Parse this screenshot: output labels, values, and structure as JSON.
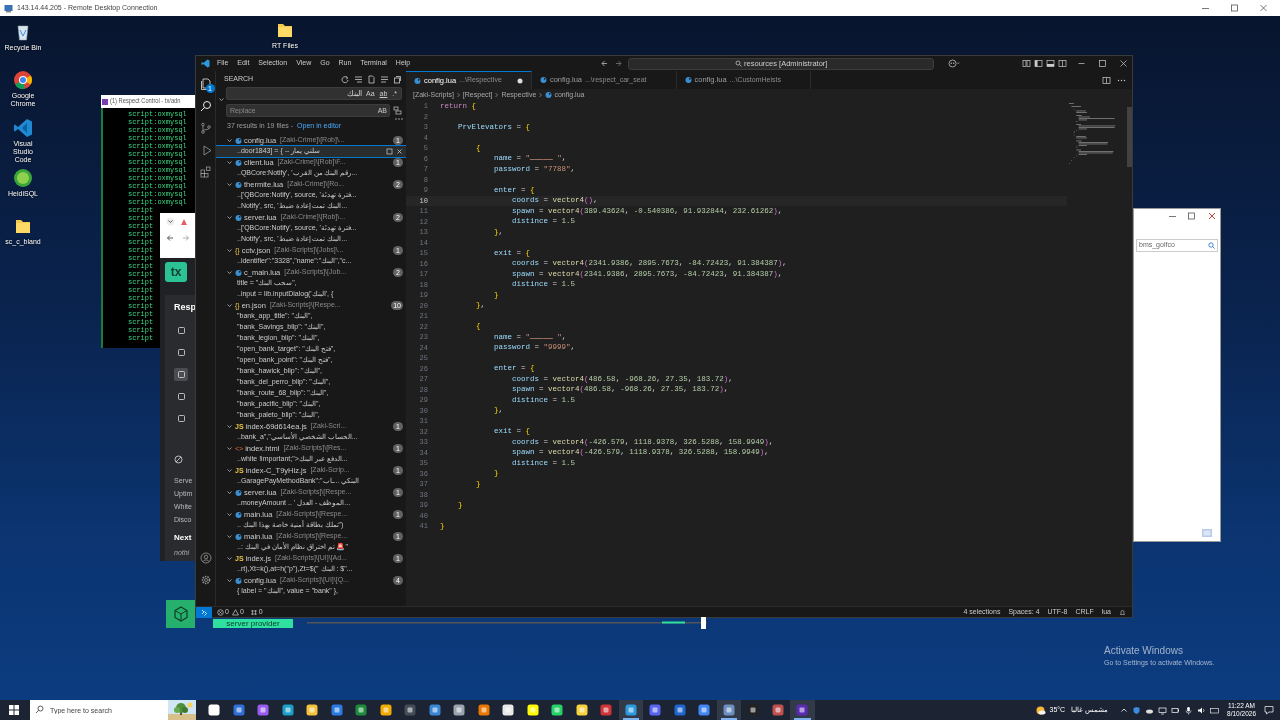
{
  "remote_window": {
    "title": "143.14.44.205 - Remote Desktop Connection"
  },
  "desktop_icons": [
    {
      "label": "Recycle Bin",
      "kind": "recycle"
    },
    {
      "label": "Google Chrome",
      "kind": "chrome"
    },
    {
      "label": "Visual Studio Code",
      "kind": "vscode"
    },
    {
      "label": "HeidiSQL",
      "kind": "heidi"
    },
    {
      "label": "sc_c_bland",
      "kind": "folder"
    },
    {
      "label": "RT Files",
      "kind": "folder"
    }
  ],
  "console_window": {
    "title": "(1) Respect Control - tx/adn",
    "lines": [
      "script:oxmysql",
      "script:oxmysql",
      "script:oxmysql",
      "script:oxmysql",
      "script:oxmysql",
      "script:oxmysql",
      "script:oxmysql",
      "script:oxmysql",
      "script:oxmysql",
      "script:oxmysql",
      "script:oxmysql",
      "script:oxmysql",
      "script",
      "script",
      "script",
      "script",
      "script",
      "script",
      "script",
      "script",
      "script",
      "script",
      "script",
      "script",
      "script",
      "script",
      "script",
      "script",
      "script"
    ]
  },
  "browser_window": {
    "logo": "tx",
    "heading": "Resp",
    "nav": [
      {
        "selected": false
      },
      {
        "selected": false
      },
      {
        "selected": true
      },
      {
        "selected": false
      },
      {
        "selected": false
      }
    ],
    "stats": [
      "Serve",
      "Uptim",
      "White",
      "Disco"
    ],
    "next_heading": "Next",
    "next_text": "nothi"
  },
  "side_window": {
    "search_value": "bms_golfco"
  },
  "editor": {
    "menu": [
      "File",
      "Edit",
      "Selection",
      "View",
      "Go",
      "Run",
      "Terminal",
      "Help"
    ],
    "command_center": "resources [Administrator]",
    "explorer_badge": "1",
    "search": {
      "title": "SEARCH",
      "query": "البنك",
      "toggles": [
        {
          "label": "Aa",
          "on": false
        },
        {
          "label": "ab",
          "on": false
        },
        {
          "label": ".*",
          "on": false
        }
      ],
      "replace_placeholder": "Replace",
      "replace_toggle": "AB",
      "summary": "37 results in 19 files - ",
      "open_link": "Open in editor",
      "files": [
        {
          "kind": "lua",
          "name": "config.lua",
          "path": "[Zaki-Crime]\\[Rob]\\...",
          "count": "1",
          "matches": [
            {
              "text": "..door1843] = { -- سلني يمار",
              "selected": true
            }
          ]
        },
        {
          "kind": "lua",
          "name": "client.lua",
          "path": "[Zaki-Crime]\\[Rob]\\F...",
          "count": "1",
          "matches": [
            {
              "text": "..QBCore:Notify', 'رقم البنك من القرب...",
              "selected": false
            }
          ]
        },
        {
          "kind": "lua",
          "name": "thermite.lua",
          "path": "[Zaki-Crime]\\[Ro...",
          "count": "2",
          "matches": [
            {
              "text": "..['QBCore:Notify', source, 'فترة تهدئة...",
              "selected": false
            },
            {
              "text": "..Notify', src, 'البنك تمت إعادة ضبط...",
              "selected": false
            }
          ]
        },
        {
          "kind": "lua",
          "name": "server.lua",
          "path": "[Zaki-Crime]\\[Rob]\\...",
          "count": "2",
          "matches": [
            {
              "text": "..['QBCore:Notify', source, 'فترة تهدئة...",
              "selected": false
            },
            {
              "text": "..Notify', src, 'البنك تمت إعادة ضبط...",
              "selected": false
            }
          ]
        },
        {
          "kind": "json",
          "icon_text": "{}",
          "name": "cctv.json",
          "path": "[Zaki-Scripts]\\[Jobs]\\...",
          "count": "1",
          "matches": [
            {
              "text": "..identifier\":\"3328\",\"name\":\"البنك\",\"c...",
              "selected": false
            }
          ]
        },
        {
          "kind": "lua",
          "name": "c_main.lua",
          "path": "[Zaki-Scripts]\\[Job...",
          "count": "2",
          "matches": [
            {
              "text": "title = \"سحب البنك\",",
              "selected": false
            },
            {
              "text": "..input = lib.inputDialog('البنك', {",
              "selected": false
            }
          ]
        },
        {
          "kind": "json",
          "icon_text": "{}",
          "name": "en.json",
          "path": "[Zaki-Scripts]\\[Respe...",
          "count": "10",
          "matches": [
            {
              "text": "\"bank_app_title\": \"البنك\",",
              "selected": false
            },
            {
              "text": "\"bank_Savings_blip\": \"البنك\",",
              "selected": false
            },
            {
              "text": "\"bank_legion_blip\": \"البنك\",",
              "selected": false
            },
            {
              "text": "\"open_bank_target\": \"فتح البنك\",",
              "selected": false
            },
            {
              "text": "\"open_bank_point\": \"فتح البنك\",",
              "selected": false
            },
            {
              "text": "\"bank_hawick_blip\": \"البنك\",",
              "selected": false
            },
            {
              "text": "\"bank_del_perro_blip\": \"البنك\",",
              "selected": false
            },
            {
              "text": "\"bank_route_68_blip\": \"البنك\",",
              "selected": false
            },
            {
              "text": "\"bank_pacific_blip\": \"البنك\",",
              "selected": false
            },
            {
              "text": "\"bank_paleto_blip\": \"البنك\",",
              "selected": false
            }
          ]
        },
        {
          "kind": "js",
          "icon_text": "JS",
          "name": "index-69d614ea.js",
          "path": "[Zaki-Scri...",
          "count": "1",
          "matches": [
            {
              "text": "..bank_a\",\"الحساب الشخصي الأساسي...",
              "selected": false
            }
          ]
        },
        {
          "kind": "html",
          "icon_text": "<>",
          "name": "index.html",
          "path": "[Zaki-Scripts]\\[Res...",
          "count": "1",
          "matches": [
            {
              "text": "..white !important;\">الدفع عبر البنك...",
              "selected": false
            }
          ]
        },
        {
          "kind": "js",
          "icon_text": "JS",
          "name": "index-C_T9yHiz.js",
          "path": "[Zaki-Scrip...",
          "count": "1",
          "matches": [
            {
              "text": "..GaragePayMethodBank\":\"البنكي ...ـاب",
              "selected": false
            }
          ]
        },
        {
          "kind": "lua",
          "name": "server.lua",
          "path": "[Zaki-Scripts]\\[Respe...",
          "count": "1",
          "matches": [
            {
              "text": "..moneyAmount .. ' الموظف - العدل...",
              "selected": false
            }
          ]
        },
        {
          "kind": "lua",
          "name": "main.lua",
          "path": "[Zaki-Scripts]\\[Respe...",
          "count": "1",
          "matches": [
            {
              "text": ".. تملك بطاقة أمنية خاصة بهذا البنك\")",
              "selected": false
            }
          ]
        },
        {
          "kind": "lua",
          "name": "main.lua",
          "path": "[Zaki-Scripts]\\[Respe...",
          "count": "1",
          "matches": [
            {
              "text": "..: تم اختراق نظام الأمان في البنك 🚨\"",
              "selected": false
            }
          ]
        },
        {
          "kind": "js",
          "icon_text": "JS",
          "name": "index.js",
          "path": "[Zaki-Scripts]\\[UI]\\[Ad...",
          "count": "1",
          "matches": [
            {
              "text": "..rt),Xt=k(),at=h(\"p\"),Zt=$(\" البنك : $\"...",
              "selected": false
            }
          ]
        },
        {
          "kind": "lua",
          "name": "config.lua",
          "path": "[Zaki-Scripts]\\[UI]\\[Q...",
          "count": "4",
          "matches": [
            {
              "text": "{ label = \"البنك\",  value = \"bank\" },",
              "selected": false
            }
          ]
        }
      ]
    },
    "tabs": [
      {
        "name": "config.lua",
        "path": "...\\RespectIve",
        "selected": true,
        "dirty": true
      },
      {
        "name": "config.lua",
        "path": "...\\respect_car_seat",
        "selected": false,
        "dirty": false
      },
      {
        "name": "config.lua",
        "path": "...\\CustomHeists",
        "selected": false,
        "dirty": false
      }
    ],
    "breadcrumb": [
      "[Zaki-Scripts]",
      "[Respect]",
      "RespectIve",
      "config.lua"
    ],
    "lines": [
      {
        "number": "1",
        "text": "return {",
        "current": false
      },
      {
        "number": "2",
        "current": false
      },
      {
        "number": "3",
        "text": "    PrvElevators = {",
        "current": false
      },
      {
        "number": "4",
        "current": false
      },
      {
        "number": "5",
        "text": "        {",
        "current": false
      },
      {
        "number": "6",
        "text": "            name = \"ـــــ \",",
        "current": false
      },
      {
        "number": "7",
        "text": "            password = \"7788\",",
        "current": false
      },
      {
        "number": "8",
        "current": false
      },
      {
        "number": "9",
        "text": "            enter = {",
        "current": false
      },
      {
        "number": "10",
        "text": "                coords = vector4(),",
        "current": true
      },
      {
        "number": "11",
        "text": "                spawn = vector4(389.43624, -0.540386, 91.932844, 232.61262),",
        "current": false
      },
      {
        "number": "12",
        "text": "                distince = 1.5",
        "current": false
      },
      {
        "number": "13",
        "text": "            },",
        "current": false
      },
      {
        "number": "14",
        "current": false
      },
      {
        "number": "15",
        "text": "            exit = {",
        "current": false
      },
      {
        "number": "16",
        "text": "                coords = vector4(2341.9386, 2895.7673, -84.72423, 91.384387),",
        "current": false
      },
      {
        "number": "17",
        "text": "                spawn = vector4(2341.9386, 2895.7673, -84.72423, 91.384387),",
        "current": false
      },
      {
        "number": "18",
        "text": "                distince = 1.5",
        "current": false
      },
      {
        "number": "19",
        "text": "            }",
        "current": false
      },
      {
        "number": "20",
        "text": "        },",
        "current": false
      },
      {
        "number": "21",
        "current": false
      },
      {
        "number": "22",
        "text": "        {",
        "current": false
      },
      {
        "number": "23",
        "text": "            name = \"ـــــ \",",
        "current": false
      },
      {
        "number": "24",
        "text": "            password = \"9999\",",
        "current": false
      },
      {
        "number": "25",
        "current": false
      },
      {
        "number": "26",
        "text": "            enter = {",
        "current": false
      },
      {
        "number": "27",
        "text": "                coords = vector4(486.58, -968.26, 27.35, 183.72),",
        "current": false
      },
      {
        "number": "28",
        "text": "                spawn = vector4(486.58, -968.26, 27.35, 183.72),",
        "current": false
      },
      {
        "number": "29",
        "text": "                distince = 1.5",
        "current": false
      },
      {
        "number": "30",
        "text": "            },",
        "current": false
      },
      {
        "number": "31",
        "current": false
      },
      {
        "number": "32",
        "text": "            exit = {",
        "current": false
      },
      {
        "number": "33",
        "text": "                coords = vector4(-426.579, 1118.9378, 326.5288, 158.9949),",
        "current": false
      },
      {
        "number": "34",
        "text": "                spawn = vector4(-426.579, 1118.9378, 326.5288, 158.9949),",
        "current": false
      },
      {
        "number": "35",
        "text": "                distince = 1.5",
        "current": false
      },
      {
        "number": "36",
        "text": "            }",
        "current": false
      },
      {
        "number": "37",
        "text": "        }",
        "current": false
      },
      {
        "number": "38",
        "current": false
      },
      {
        "number": "39",
        "text": "    }",
        "current": false
      },
      {
        "number": "40",
        "current": false
      },
      {
        "number": "41",
        "text": "}",
        "current": false
      }
    ],
    "status_bar": {
      "errors": "0",
      "warnings": "0",
      "ports": "0",
      "items": [
        "4 selections",
        "Spaces: 4",
        "UTF-8",
        "CRLF",
        "lua"
      ]
    }
  },
  "overlay_badge": "server provider",
  "activation": {
    "title": "Activate Windows",
    "text": "Go to Settings to activate Windows."
  },
  "taskbar": {
    "search_placeholder": "Type here to search",
    "apps": [
      {
        "kind": "taskview",
        "running": false
      },
      {
        "kind": "calendar",
        "running": false
      },
      {
        "kind": "copilot",
        "running": false
      },
      {
        "kind": "edge",
        "running": false
      },
      {
        "kind": "explorer",
        "running": false
      },
      {
        "kind": "mail",
        "running": false
      },
      {
        "kind": "green",
        "running": false
      },
      {
        "kind": "yellow",
        "running": false
      },
      {
        "kind": "camera",
        "running": false
      },
      {
        "kind": "photos",
        "running": false
      },
      {
        "kind": "mic",
        "running": false
      },
      {
        "kind": "blender",
        "running": false
      },
      {
        "kind": "capcut",
        "running": false
      },
      {
        "kind": "snap",
        "running": false
      },
      {
        "kind": "whatsapp",
        "running": false
      },
      {
        "kind": "notes",
        "running": false
      },
      {
        "kind": "red",
        "running": false
      },
      {
        "kind": "vscode",
        "running": true
      },
      {
        "kind": "discord",
        "running": false
      },
      {
        "kind": "blue",
        "running": false
      },
      {
        "kind": "chrome",
        "running": false
      },
      {
        "kind": "rdp",
        "running": true
      },
      {
        "kind": "terminal",
        "running": false
      },
      {
        "kind": "media",
        "running": false
      },
      {
        "kind": "purple",
        "running": true
      }
    ],
    "temperature": "35°C",
    "weather": "مشمس غالبا",
    "time": "11:22 AM",
    "date": "8/10/2026"
  }
}
